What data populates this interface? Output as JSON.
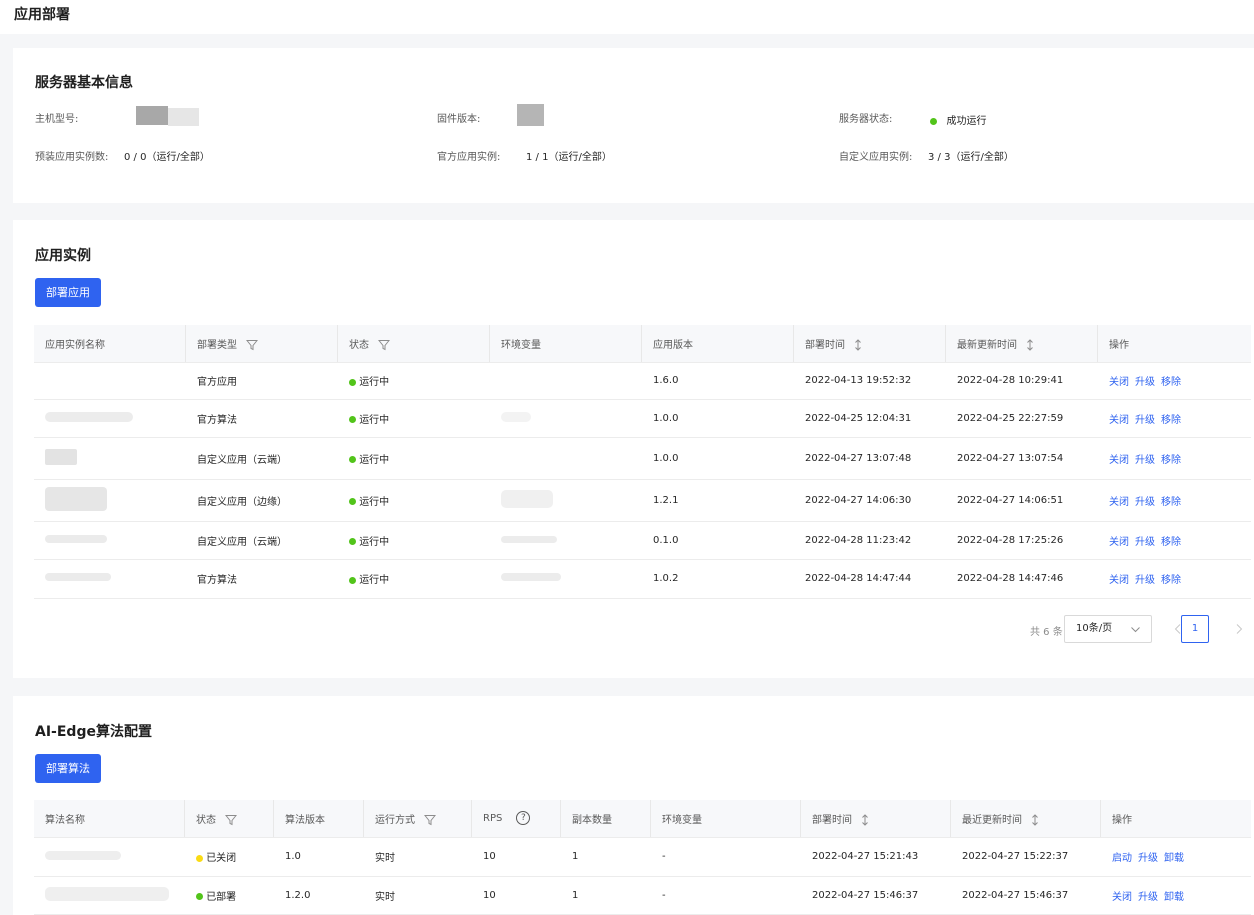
{
  "header": {
    "title": "应用部署"
  },
  "server_info": {
    "title": "服务器基本信息",
    "host_model_label": "主机型号:",
    "firmware_label": "固件版本:",
    "status_label": "服务器状态:",
    "status_value": "成功运行",
    "preinstalled_label": "预装应用实例数:",
    "preinstalled_value": "0 / 0（运行/全部）",
    "official_label": "官方应用实例:",
    "official_value": "1 / 1（运行/全部）",
    "custom_label": "自定义应用实例:",
    "custom_value": "3 / 3（运行/全部）",
    "status_color": "#52c41a"
  },
  "app_instances": {
    "title": "应用实例",
    "deploy_button": "部署应用",
    "columns": [
      "应用实例名称",
      "部署类型",
      "状态",
      "环境变量",
      "应用版本",
      "部署时间",
      "最新更新时间",
      "操作"
    ],
    "rows": [
      {
        "type": "官方应用",
        "status": "运行中",
        "version": "1.6.0",
        "deployed": "2022-04-13 19:52:32",
        "updated": "2022-04-28 10:29:41"
      },
      {
        "type": "官方算法",
        "status": "运行中",
        "version": "1.0.0",
        "deployed": "2022-04-25 12:04:31",
        "updated": "2022-04-25 22:27:59"
      },
      {
        "type": "自定义应用（云端）",
        "status": "运行中",
        "version": "1.0.0",
        "deployed": "2022-04-27 13:07:48",
        "updated": "2022-04-27 13:07:54"
      },
      {
        "type": "自定义应用（边缘）",
        "status": "运行中",
        "version": "1.2.1",
        "deployed": "2022-04-27 14:06:30",
        "updated": "2022-04-27 14:06:51"
      },
      {
        "type": "自定义应用（云端）",
        "status": "运行中",
        "version": "0.1.0",
        "deployed": "2022-04-28 11:23:42",
        "updated": "2022-04-28 17:25:26"
      },
      {
        "type": "官方算法",
        "status": "运行中",
        "version": "1.0.2",
        "deployed": "2022-04-28 14:47:44",
        "updated": "2022-04-28 14:47:46"
      }
    ],
    "actions": {
      "close": "关闭",
      "upgrade": "升级",
      "remove": "移除"
    },
    "pagination": {
      "total": "共 6 条",
      "page_size": "10条/页",
      "current_page": "1"
    }
  },
  "ai_edge": {
    "title": "AI-Edge算法配置",
    "deploy_button": "部署算法",
    "columns": [
      "算法名称",
      "状态",
      "算法版本",
      "运行方式",
      "RPS",
      "副本数量",
      "环境变量",
      "部署时间",
      "最近更新时间",
      "操作"
    ],
    "rps_help": "?",
    "rows": [
      {
        "status": "已关闭",
        "status_color": "#fadb14",
        "version": "1.0",
        "mode": "实时",
        "rps": "10",
        "replicas": "1",
        "env": "-",
        "deployed": "2022-04-27 15:21:43",
        "updated": "2022-04-27 15:22:37",
        "action1": "启动",
        "action2": "升级",
        "action3": "卸载"
      },
      {
        "status": "已部署",
        "status_color": "#52c41a",
        "version": "1.2.0",
        "mode": "实时",
        "rps": "10",
        "replicas": "1",
        "env": "-",
        "deployed": "2022-04-27 15:46:37",
        "updated": "2022-04-27 15:46:37",
        "action1": "关闭",
        "action2": "升级",
        "action3": "卸载"
      }
    ]
  }
}
